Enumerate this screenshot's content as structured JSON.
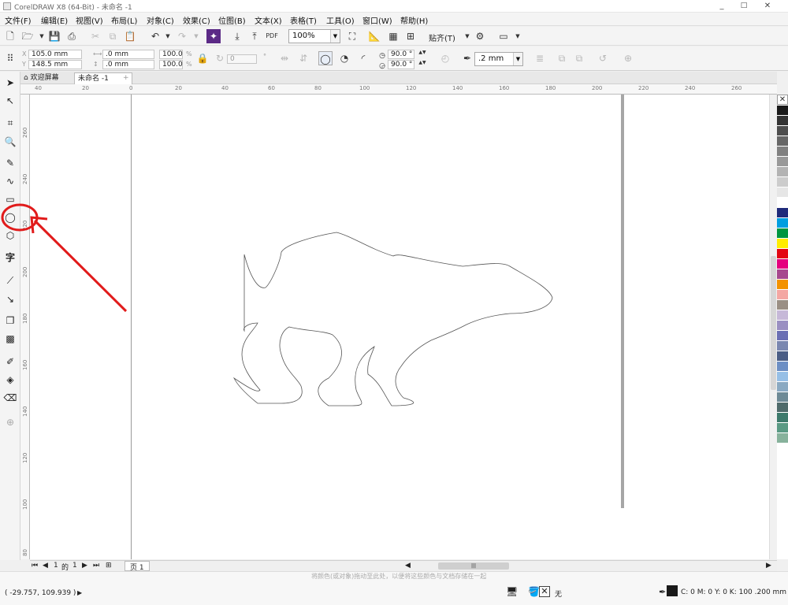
{
  "titlebar": {
    "title": "CorelDRAW X8 (64-Bit) - 未命名 -1",
    "min": "_",
    "max": "□",
    "close": "✕"
  },
  "menus": [
    "文件(F)",
    "编辑(E)",
    "视图(V)",
    "布局(L)",
    "对象(C)",
    "效果(C)",
    "位图(B)",
    "文本(X)",
    "表格(T)",
    "工具(O)",
    "窗口(W)",
    "帮助(H)"
  ],
  "toolbar": {
    "zoom_value": "100%",
    "snap_label": "贴齐(T)",
    "pdf_label": "PDF"
  },
  "property_bar": {
    "x": "105.0 mm",
    "y": "148.5 mm",
    "width": ".0 mm",
    "height": ".0 mm",
    "scale_x": "100.0",
    "scale_y": "100.0",
    "pct": "%",
    "rotation": "0",
    "start_angle": "90.0 °",
    "end_angle": "90.0 °",
    "outline_width": ".2 mm"
  },
  "doc_tabs": {
    "welcome": "欢迎屏幕",
    "document": "未命名 -1",
    "add": "+"
  },
  "ruler_h": [
    "40",
    "20",
    "0",
    "20",
    "40",
    "60",
    "80",
    "100",
    "120",
    "140",
    "160",
    "180",
    "200",
    "220",
    "240",
    "260"
  ],
  "ruler_v": [
    "260",
    "240",
    "220",
    "200",
    "180",
    "160",
    "140",
    "120",
    "100",
    "80"
  ],
  "page_nav": {
    "current": "1",
    "of": "的",
    "total": "1",
    "page_tab": "页 1"
  },
  "status": {
    "coordinates": "( -29.757, 109.939 )",
    "hint": "将颜色(或对象)拖动至此处，以便将这些颜色与文档存储在一起",
    "fill_label": "无",
    "color_info": "C: 0 M: 0 Y: 0 K: 100  .200 mm"
  },
  "palette_colors": [
    "#1a1a1a",
    "#333333",
    "#4d4d4d",
    "#666666",
    "#808080",
    "#999999",
    "#b3b3b3",
    "#cccccc",
    "#e6e6e6",
    "#ffffff",
    "#1f2a7a",
    "#009ee0",
    "#00963f",
    "#ffed00",
    "#e30613",
    "#e5007e",
    "#a7488e",
    "#f39200",
    "#f4a7a3",
    "#9a8f84",
    "#c6b8d8",
    "#9a8fc2",
    "#6b6fb4",
    "#7a87b0",
    "#4a5d85",
    "#6d8fc4",
    "#96bfe6",
    "#8aa9c2",
    "#6e8a96",
    "#4f6b6b",
    "#3d7a6c",
    "#5a9a84",
    "#87b29c"
  ],
  "accent": "#e11b1b"
}
